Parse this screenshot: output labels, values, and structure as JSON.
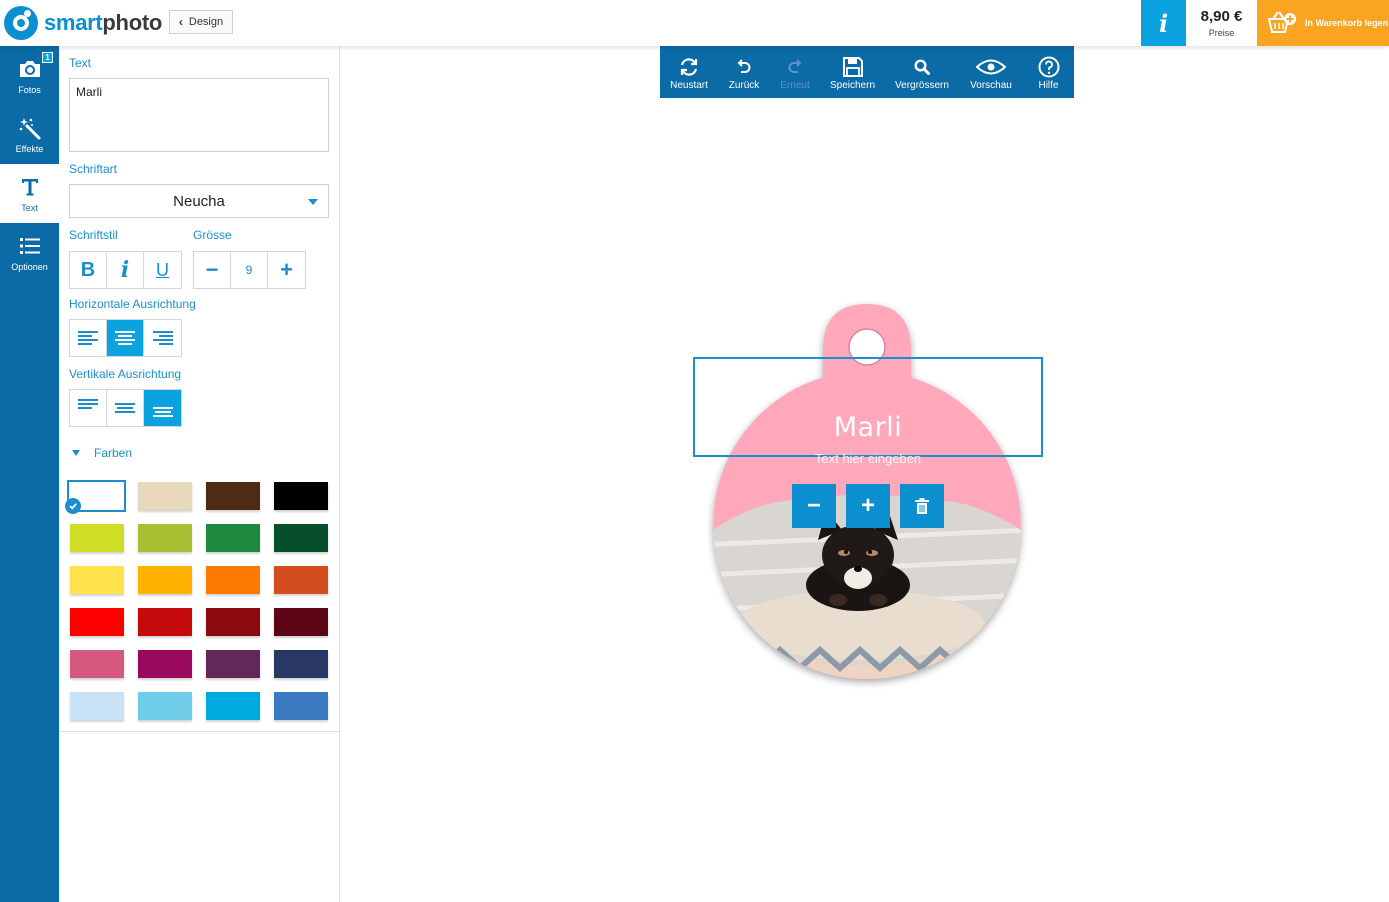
{
  "header": {
    "brand_smart": "smart",
    "brand_photo": "photo",
    "back_label": "Design",
    "info_label": "i",
    "price": "8,90 €",
    "price_label": "Preise",
    "cart_label": "In Warenkorb legen"
  },
  "rail": {
    "items": [
      {
        "label": "Fotos",
        "badge": "1"
      },
      {
        "label": "Effekte"
      },
      {
        "label": "Text"
      },
      {
        "label": "Optionen"
      }
    ],
    "active": "Text"
  },
  "panel": {
    "text_label": "Text",
    "text_value": "Marli",
    "font_label": "Schriftart",
    "font_value": "Neucha",
    "style_label": "Schriftstil",
    "bold": "B",
    "italic": "i",
    "underline": "U",
    "size_label": "Grösse",
    "size_minus": "−",
    "size_value": "9",
    "size_plus": "+",
    "h_align_label": "Horizontale Ausrichtung",
    "h_align_selected": "center",
    "v_align_label": "Vertikale Ausrichtung",
    "v_align_selected": "bottom",
    "colors_label": "Farben",
    "selected_color": "#ffffff",
    "colors": [
      "#ffffff",
      "#e8d8bd",
      "#4e2b16",
      "#000000",
      "#cfdd26",
      "#a8c133",
      "#1d8a3e",
      "#074f2a",
      "#ffe24d",
      "#ffb300",
      "#ff7a00",
      "#d34d1f",
      "#ff0000",
      "#c40a0a",
      "#8c0a0f",
      "#5b0515",
      "#d55a7d",
      "#990a5c",
      "#63275a",
      "#283764",
      "#c9e2f5",
      "#6fcde8",
      "#00aade",
      "#3b7ac1"
    ]
  },
  "toolbar": {
    "restart": "Neustart",
    "undo": "Zurück",
    "redo": "Erneut",
    "save": "Speichern",
    "zoom": "Vergrössern",
    "preview": "Vorschau",
    "help": "Hilfe"
  },
  "canvas": {
    "pendant_text": "Marli",
    "placeholder": "Text hier eingeben",
    "minus": "−",
    "plus": "+",
    "pendant_color": "#ffa7bb",
    "accent": "#0b6ba6"
  }
}
